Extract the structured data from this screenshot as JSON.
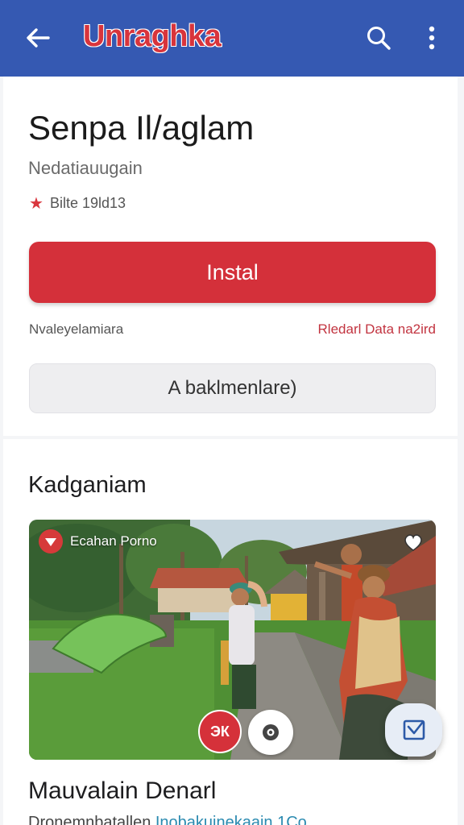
{
  "appbar": {
    "title": "Unraghka",
    "back_icon": "arrow-left-icon",
    "search_icon": "search-icon",
    "more_icon": "more-vertical-icon",
    "color": "#3559b2"
  },
  "app": {
    "name": "Senpa Il/aglam",
    "developer": "Nedatiauugain",
    "rating_text": "Bilte 19ld13",
    "rating_icon": "star-icon"
  },
  "actions": {
    "install_label": "Instal",
    "install_color": "#d4303a",
    "info_left": "Nvaleyelamiara",
    "info_right": "Rledarl Data na2ird",
    "secondary_label": "A baklmenlare)"
  },
  "section": {
    "title": "Kadganiam"
  },
  "media": {
    "channel_label": "Ecahan Porno",
    "red_chip_label": "ЭК",
    "camera_icon": "camera-icon",
    "favorite_icon": "favorite-icon"
  },
  "fab": {
    "icon": "compose-icon"
  },
  "item": {
    "title": "Mauvalain Denarl",
    "subtitle_plain": "Dronemnbatallen ",
    "subtitle_link": "Inobakuinekaain 1Co"
  }
}
